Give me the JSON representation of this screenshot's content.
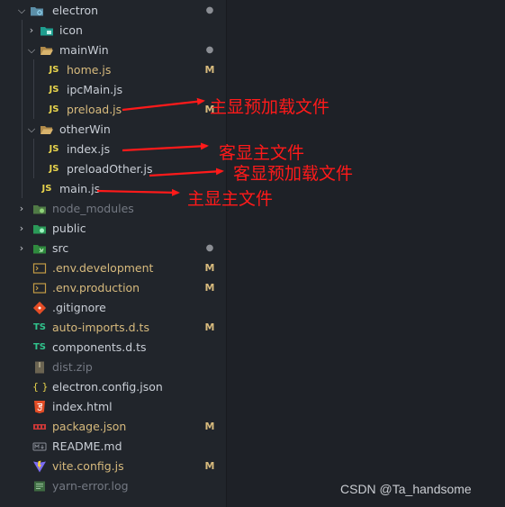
{
  "explorer": {
    "rows": [
      {
        "label": "electron",
        "badge": "●"
      },
      {
        "label": "icon",
        "badge": ""
      },
      {
        "label": "mainWin",
        "badge": "●"
      },
      {
        "label": "home.js",
        "badge": "M"
      },
      {
        "label": "ipcMain.js",
        "badge": ""
      },
      {
        "label": "preload.js",
        "badge": "M"
      },
      {
        "label": "otherWin",
        "badge": ""
      },
      {
        "label": "index.js",
        "badge": ""
      },
      {
        "label": "preloadOther.js",
        "badge": ""
      },
      {
        "label": "main.js",
        "badge": ""
      },
      {
        "label": "node_modules",
        "badge": ""
      },
      {
        "label": "public",
        "badge": ""
      },
      {
        "label": "src",
        "badge": "●"
      },
      {
        "label": ".env.development",
        "badge": "M"
      },
      {
        "label": ".env.production",
        "badge": "M"
      },
      {
        "label": ".gitignore",
        "badge": ""
      },
      {
        "label": "auto-imports.d.ts",
        "badge": "M"
      },
      {
        "label": "components.d.ts",
        "badge": ""
      },
      {
        "label": "dist.zip",
        "badge": ""
      },
      {
        "label": "electron.config.json",
        "badge": ""
      },
      {
        "label": "index.html",
        "badge": ""
      },
      {
        "label": "package.json",
        "badge": "M"
      },
      {
        "label": "README.md",
        "badge": ""
      },
      {
        "label": "vite.config.js",
        "badge": "M"
      },
      {
        "label": "yarn-error.log",
        "badge": ""
      }
    ]
  },
  "annotations": {
    "preload": "主显预加载文件",
    "index": "客显主文件",
    "preloadOther": "客显预加载文件",
    "main": "主显主文件"
  },
  "icons": {
    "js_glyph": "JS",
    "ts_glyph": "TS",
    "json_glyph": "{ }"
  },
  "colors": {
    "js": "#e8d44d",
    "ts": "#31c48d",
    "folder": "#c5a05a",
    "modified": "#d7ba7d",
    "arrow": "#ff1a1a"
  },
  "watermark": "CSDN @Ta_handsome"
}
